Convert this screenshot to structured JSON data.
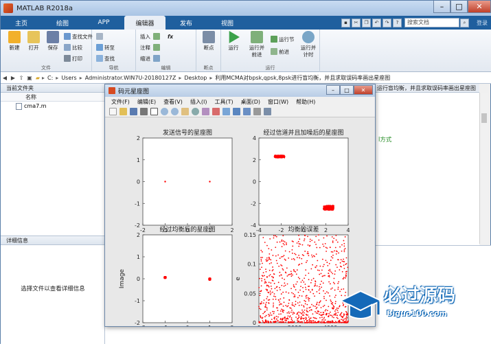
{
  "window": {
    "title": "MATLAB R2018a"
  },
  "tabs": [
    "主页",
    "绘图",
    "APP",
    "编辑器",
    "发布",
    "视图"
  ],
  "active_tab": "编辑器",
  "search": {
    "placeholder": "搜索文档"
  },
  "login": "登录",
  "ribbon": {
    "file": {
      "label": "文件",
      "new": "新建",
      "open": "打开",
      "save": "保存",
      "find_files": "查找文件",
      "compare": "比较",
      "print": "打印"
    },
    "navigate": {
      "label": "导航",
      "goto": "转至",
      "find": "查找"
    },
    "edit": {
      "label": "编辑",
      "insert": "插入",
      "comment": "注释",
      "indent": "缩进",
      "fx": "fx"
    },
    "breakpoints": {
      "label": "断点",
      "breakpoints": "断点"
    },
    "run": {
      "label": "运行",
      "run": "运行",
      "run_advance": "运行并\n前进",
      "run_section": "运行节",
      "advance": "前进",
      "run_time": "运行并\n计时"
    }
  },
  "address": {
    "segments": [
      "C:",
      "Users",
      "Administrator.WIN7U-20180127Z",
      "Desktop",
      "利用MCMA对bpsk,qpsk,8psk进行盲均衡，并且求取误码率画出星座图"
    ]
  },
  "left_panel": {
    "title": "当前文件夹",
    "col_name": "名称",
    "files": [
      "cma7.m"
    ],
    "details_title": "详细信息",
    "details_msg": "选择文件以查看详细信息"
  },
  "editor": {
    "tab_text": "运行盲均衡，并且求取误码率画出星座图",
    "code_fragment": "l方式"
  },
  "figure": {
    "title": "码元星座图",
    "menu": [
      "文件(F)",
      "编辑(E)",
      "查看(V)",
      "插入(I)",
      "工具(T)",
      "桌面(D)",
      "窗口(W)",
      "帮助(H)"
    ]
  },
  "chart_data": [
    {
      "type": "scatter",
      "title": "发送信号的星座图",
      "xlabel": "",
      "ylabel": "",
      "xlim": [
        -2,
        2
      ],
      "ylim": [
        -2,
        2
      ],
      "xticks": [
        -2,
        -1,
        0,
        1,
        2
      ],
      "yticks": [
        -2,
        -1,
        0,
        1,
        2
      ],
      "color": "#ff0000",
      "series": [
        {
          "x": [
            -1,
            1
          ],
          "y": [
            0,
            0
          ]
        }
      ]
    },
    {
      "type": "scatter",
      "title": "经过信道并且加噪后的星座图",
      "xlabel": "",
      "ylabel": "",
      "xlim": [
        -4,
        4
      ],
      "ylim": [
        -4,
        4
      ],
      "xticks": [
        -4,
        -2,
        0,
        2,
        4
      ],
      "yticks": [
        -4,
        -2,
        0,
        2,
        4
      ],
      "color": "#ff0000",
      "clusters": [
        {
          "x": [
            -2.6,
            -1.7
          ],
          "y": [
            2.2,
            2.4
          ]
        },
        {
          "x": [
            1.8,
            2.7
          ],
          "y": [
            -2.6,
            -2.2
          ]
        }
      ]
    },
    {
      "type": "scatter",
      "title": "经过均衡后的星座图",
      "xlabel": "Real",
      "ylabel": "Image",
      "xlim": [
        -2,
        2
      ],
      "ylim": [
        -2,
        2
      ],
      "xticks": [
        -2,
        -1,
        0,
        1,
        2
      ],
      "yticks": [
        -2,
        -1,
        0,
        1,
        2
      ],
      "color": "#ff0000",
      "clusters": [
        {
          "x": [
            -1.03,
            -0.97
          ],
          "y": [
            0.03,
            0.09
          ]
        },
        {
          "x": [
            0.97,
            1.03
          ],
          "y": [
            -0.05,
            0.02
          ]
        }
      ]
    },
    {
      "type": "scatter",
      "title": "均衡的误差",
      "xlabel": "n",
      "ylabel": "e",
      "xlim": [
        0,
        5000
      ],
      "ylim": [
        0,
        0.15
      ],
      "xticks": [
        0,
        2000,
        4000
      ],
      "yticks": [
        0,
        0.05,
        0.1,
        0.15
      ],
      "color": "#ff0000",
      "noise": {
        "n": 5000,
        "ymax": 0.15
      }
    }
  ],
  "watermark": {
    "cn": "必过源码",
    "en": "Biguo100.com"
  }
}
